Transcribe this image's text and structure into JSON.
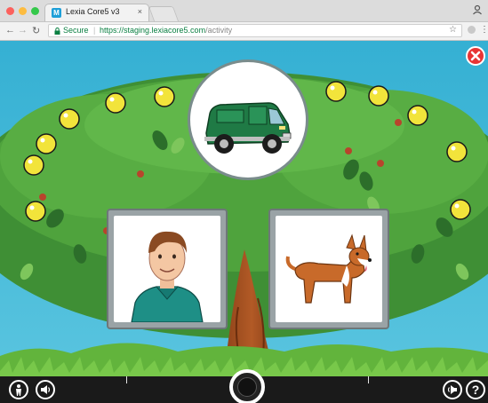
{
  "browser": {
    "tab_title": "Lexia Core5 v3",
    "tab_close": "×",
    "favicon_letter": "M",
    "secure_label": "Secure",
    "url_scheme_host": "https://staging.lexiacore5.com",
    "url_path": "/activity"
  },
  "game": {
    "prompt_picture": "green-van",
    "choices": [
      {
        "picture": "man"
      },
      {
        "picture": "dog"
      }
    ]
  },
  "toolbar": {
    "help_glyph": "?"
  },
  "colors": {
    "sky": "#2fa3c9",
    "tree_foliage": "#4a9a3a",
    "grass": "#5fb03a",
    "apple": "#f1e33a",
    "close_button": "#e83434",
    "secure_green": "#0b8043"
  }
}
